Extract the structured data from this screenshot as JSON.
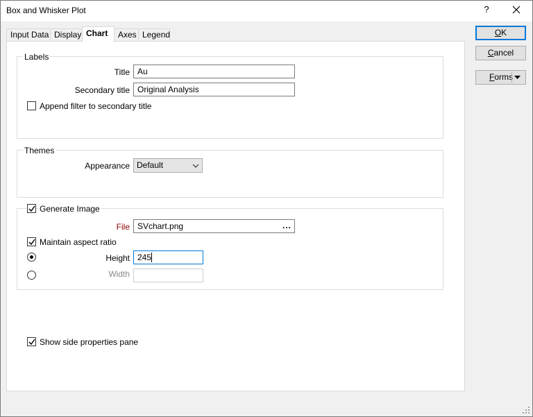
{
  "window": {
    "title": "Box and Whisker Plot",
    "help_label": "?",
    "close_icon": "close-icon"
  },
  "tabs": [
    {
      "label": "Input Data",
      "active": false
    },
    {
      "label": "Display",
      "active": false
    },
    {
      "label": "Chart",
      "active": true
    },
    {
      "label": "Axes",
      "active": false
    },
    {
      "label": "Legend",
      "active": false
    }
  ],
  "labels_group": {
    "heading": "Labels",
    "title_label": "Title",
    "title_value": "Au",
    "secondary_label": "Secondary title",
    "secondary_value": "Original Analysis",
    "append_filter_label": "Append filter to secondary title",
    "append_filter_checked": false
  },
  "themes_group": {
    "heading": "Themes",
    "appearance_label": "Appearance",
    "appearance_value": "Default"
  },
  "image_group": {
    "generate_label": "Generate Image",
    "generate_checked": true,
    "file_label": "File",
    "file_value": "SVchart.png",
    "browse_label": "...",
    "aspect_label": "Maintain aspect ratio",
    "aspect_checked": true,
    "height_label": "Height",
    "height_value": "245",
    "height_selected": true,
    "width_label": "Width",
    "width_value": "",
    "width_selected": false
  },
  "side_pane": {
    "label": "Show side properties pane",
    "checked": true
  },
  "buttons": {
    "ok": {
      "accel": "O",
      "rest": "K"
    },
    "cancel": {
      "accel": "C",
      "rest": "ancel"
    },
    "forms": {
      "accel": "F",
      "rest": "orms"
    }
  },
  "colors": {
    "accent": "#0078d7",
    "required_label": "#8b0000",
    "disabled_text": "#8a8a8a"
  }
}
